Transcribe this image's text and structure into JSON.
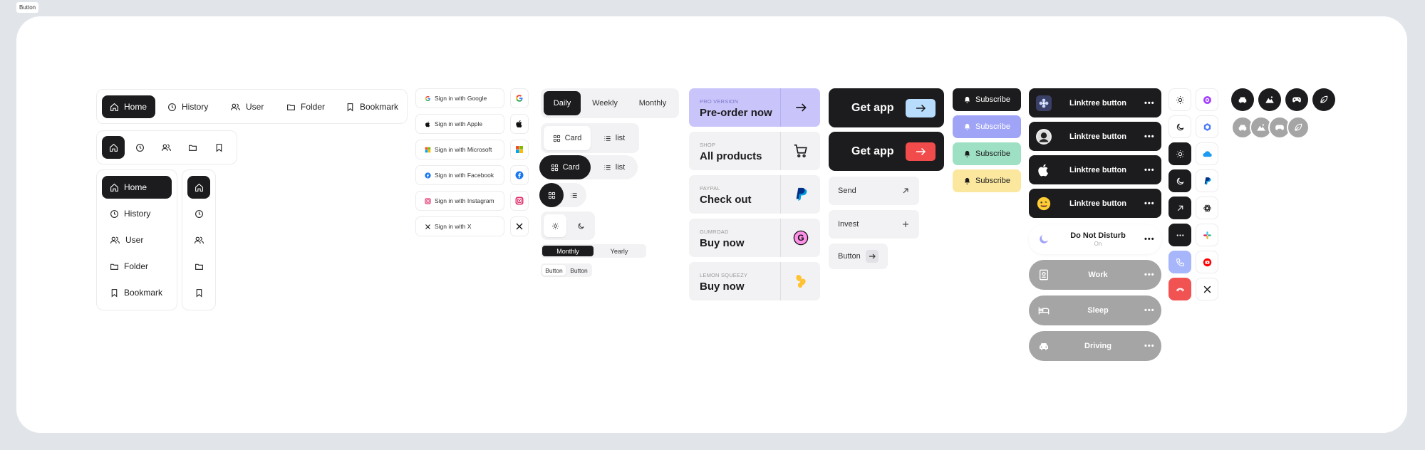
{
  "frame_label": "Button",
  "colors": {
    "dark": "#1c1c1e",
    "lavender": "#c9c5fb",
    "blue_accent": "#b8dcfc",
    "red_accent": "#f24b4b",
    "sub_blue": "#9fa4f7",
    "sub_green": "#9ee0c4",
    "sub_yellow": "#fbe79e",
    "grey_pill": "#a5a5a5",
    "call_blue": "#a7b6fb",
    "call_red": "#f15252"
  },
  "nav_horizontal": [
    {
      "label": "Home",
      "icon": "home-icon"
    },
    {
      "label": "History",
      "icon": "clock-icon"
    },
    {
      "label": "User",
      "icon": "users-icon"
    },
    {
      "label": "Folder",
      "icon": "folder-icon"
    },
    {
      "label": "Bookmark",
      "icon": "bookmark-icon"
    }
  ],
  "nav_vertical": [
    {
      "label": "Home",
      "icon": "home-icon"
    },
    {
      "label": "History",
      "icon": "clock-icon"
    },
    {
      "label": "User",
      "icon": "users-icon"
    },
    {
      "label": "Folder",
      "icon": "folder-icon"
    },
    {
      "label": "Bookmark",
      "icon": "bookmark-icon"
    }
  ],
  "signin": [
    {
      "label": "Sign in with Google",
      "icon": "google-icon"
    },
    {
      "label": "Sign in with Apple",
      "icon": "apple-icon"
    },
    {
      "label": "Sign in with Microsoft",
      "icon": "microsoft-icon"
    },
    {
      "label": "Sign in with Facebook",
      "icon": "facebook-icon"
    },
    {
      "label": "Sign in with Instagram",
      "icon": "instagram-icon"
    },
    {
      "label": "Sign in with X",
      "icon": "x-icon"
    }
  ],
  "period_toggle": {
    "options": [
      "Daily",
      "Weekly",
      "Monthly"
    ],
    "selected": "Daily"
  },
  "view_toggle_light": {
    "options": [
      "Card",
      "list"
    ],
    "selected": "Card"
  },
  "view_toggle_dark": {
    "options": [
      "Card",
      "list"
    ],
    "selected": "Card"
  },
  "billing_toggle": {
    "options": [
      "Monthly",
      "Yearly"
    ],
    "selected": "Monthly"
  },
  "tiny_buttons": [
    "Button",
    "Button"
  ],
  "pay_cards": [
    {
      "eyebrow": "PRO VERSION",
      "title": "Pre-order now",
      "icon": "arrow-right-icon"
    },
    {
      "eyebrow": "SHOP",
      "title": "All products",
      "icon": "cart-icon"
    },
    {
      "eyebrow": "PAYPAL",
      "title": "Check out",
      "icon": "paypal-icon"
    },
    {
      "eyebrow": "GUMROAD",
      "title": "Buy now",
      "icon": "gumroad-icon"
    },
    {
      "eyebrow": "LEMON SQUEEZY",
      "title": "Buy now",
      "icon": "lemon-squeezy-icon"
    }
  ],
  "get_app": [
    {
      "label": "Get app"
    },
    {
      "label": "Get app"
    }
  ],
  "light_buttons": [
    {
      "label": "Send",
      "icon": "arrow-up-right-icon"
    },
    {
      "label": "Invest",
      "icon": "plus-icon"
    },
    {
      "label": "Button",
      "icon": "arrow-right-icon"
    }
  ],
  "subscribe": [
    "Subscribe",
    "Subscribe",
    "Subscribe",
    "Subscribe"
  ],
  "linktree": [
    {
      "label": "Linktree button",
      "avatar": "flower-avatar"
    },
    {
      "label": "Linktree button",
      "avatar": "person-avatar"
    },
    {
      "label": "Linktree button",
      "avatar": "apple-icon"
    },
    {
      "label": "Linktree button",
      "avatar": "emoji-avatar"
    }
  ],
  "dnd": {
    "title": "Do Not Disturb",
    "status": "On"
  },
  "focus_modes": [
    {
      "label": "Work",
      "icon": "badge-icon"
    },
    {
      "label": "Sleep",
      "icon": "bed-icon"
    },
    {
      "label": "Driving",
      "icon": "car-icon"
    }
  ]
}
